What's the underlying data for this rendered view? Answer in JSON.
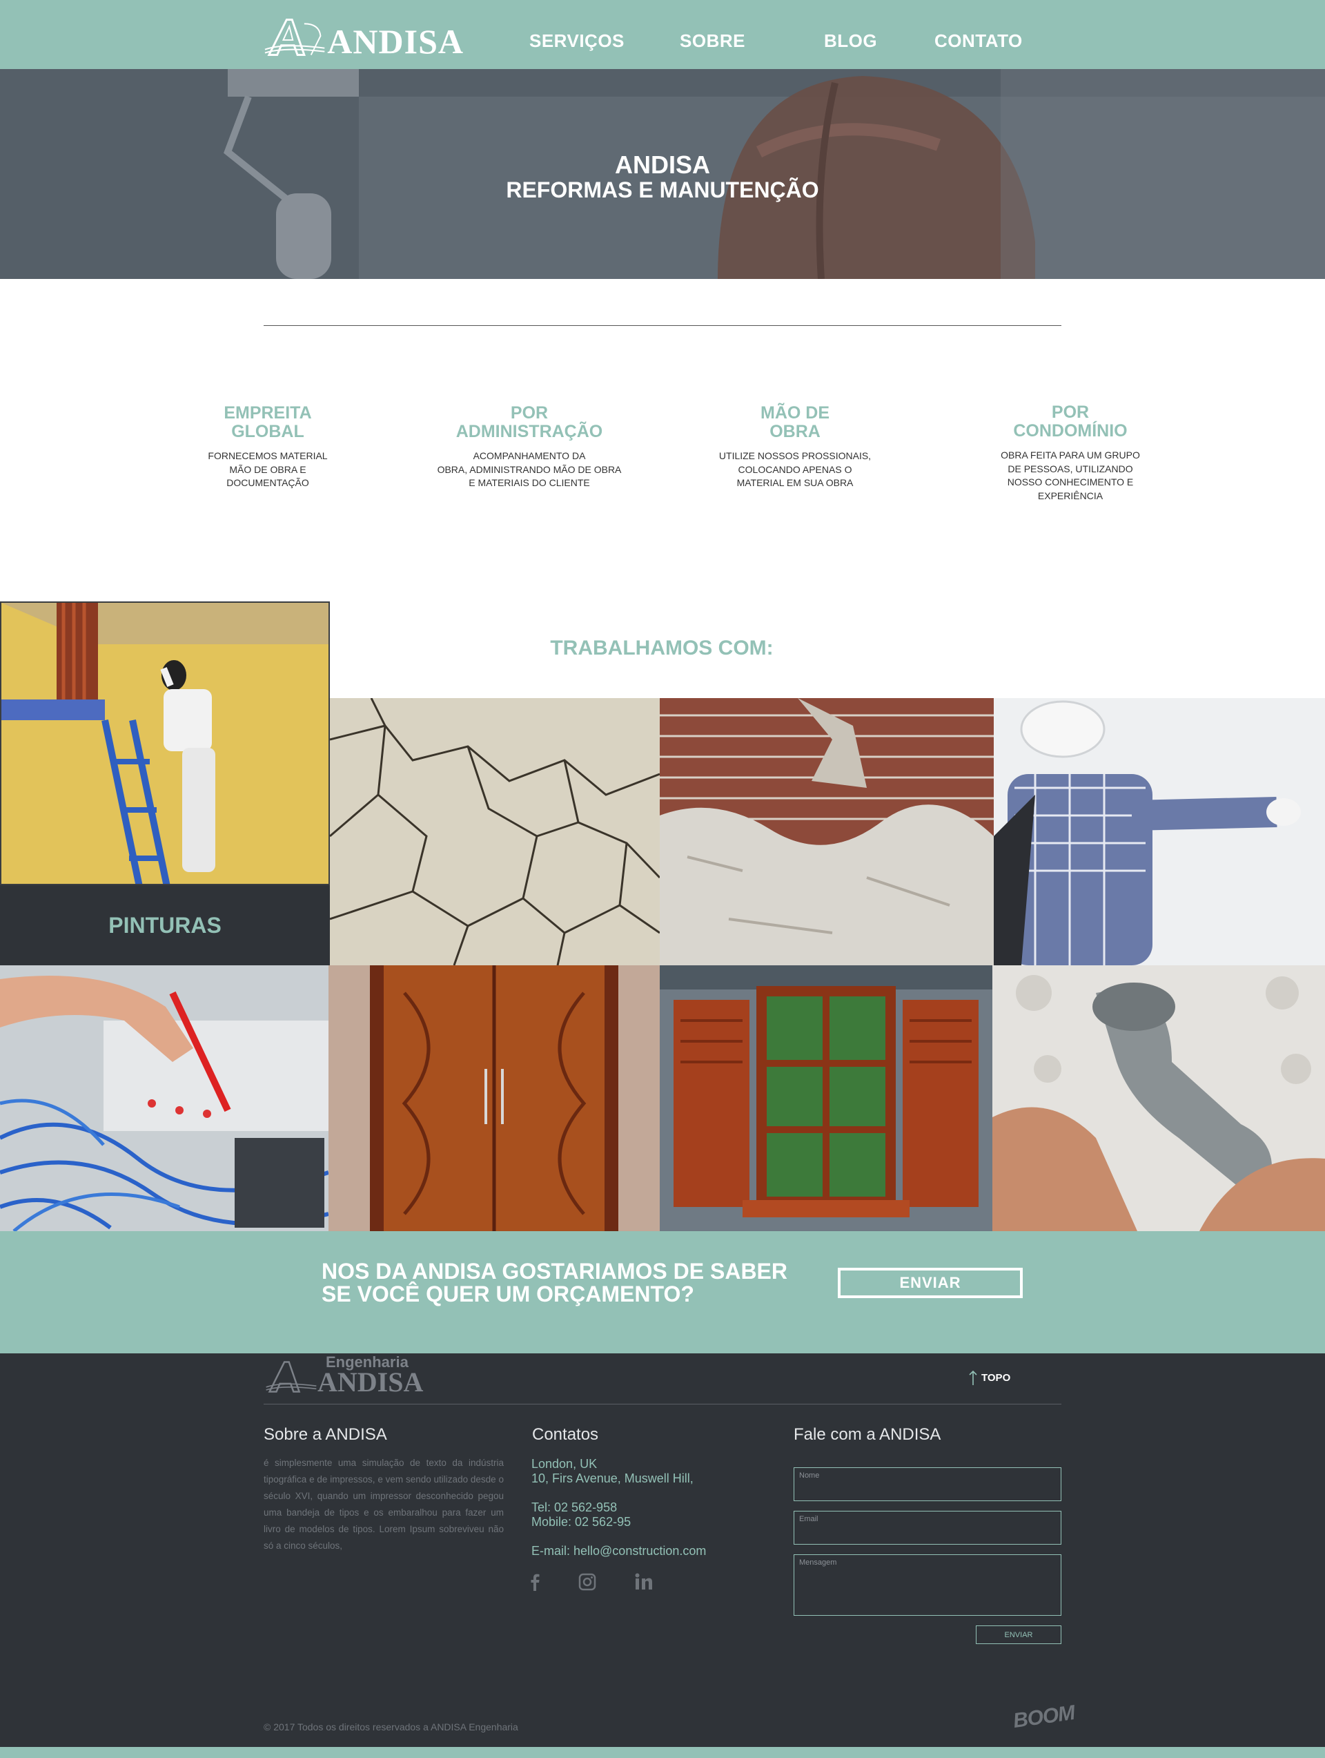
{
  "header": {
    "logo_text": "ANDISA",
    "nav": [
      "SERVIÇOS",
      "SOBRE",
      "BLOG",
      "CONTATO"
    ]
  },
  "hero": {
    "title": "ANDISA",
    "subtitle": "REFORMAS E MANUTENÇÃO"
  },
  "services": [
    {
      "title": "EMPREITA\nGLOBAL",
      "text": "FORNECEMOS MATERIAL\nMÃO DE OBRA E\nDOCUMENTAÇÃO"
    },
    {
      "title": "POR\nADMINISTRAÇÃO",
      "text": "ACOMPANHAMENTO DA\nOBRA, ADMINISTRANDO MÃO DE OBRA\nE MATERIAIS DO CLIENTE"
    },
    {
      "title": "MÃO DE\nOBRA",
      "text": "UTILIZE NOSSOS PROSSIONAIS,\nCOLOCANDO APENAS O\nMATERIAL EM SUA OBRA"
    },
    {
      "title": "POR\nCONDOMÍNIO",
      "text": "OBRA FEITA PARA UM GRUPO\nDE PESSOAS, UTILIZANDO\nNOSSO CONHECIMENTO E\nEXPERIÊNCIA"
    }
  ],
  "works": {
    "title": "TRABALHAMOS COM:",
    "painting_label": "PINTURAS"
  },
  "cta": {
    "line1": "NOS DA ANDISA GOSTARIAMOS  DE SABER",
    "line2": "SE VOCÊ QUER UM ORÇAMENTO?",
    "button": "ENVIAR"
  },
  "footer": {
    "logo_small": "Engenharia",
    "logo_name": "ANDISA",
    "top_link": "TOPO",
    "about_title": "Sobre a ANDISA",
    "about_text": "é simplesmente uma simulação de texto da indústria tipográfica e de impressos, e vem sendo utilizado desde o século XVI, quando um impressor desconhecido pegou uma bandeja de tipos e os embaralhou para fazer um livro de modelos de tipos. Lorem Ipsum sobreviveu não só a cinco séculos,",
    "contacts_title": "Contatos",
    "address1": "London, UK",
    "address2": "10, Firs Avenue, Muswell Hill,",
    "tel": "Tel: 02 562-958",
    "mobile": "Mobile: 02 562-95",
    "email": "E-mail: hello@construction.com",
    "form_title": "Fale com a ANDISA",
    "form_name": "Nome",
    "form_email": "Email",
    "form_message": "Mensagem",
    "form_button": "ENVIAR",
    "copyright": "© 2017  Todos os direitos reservados a ANDISA Engenharia",
    "credit": "BOOM"
  },
  "colors": {
    "accent": "#93c1b6",
    "dark": "#2f3338"
  }
}
